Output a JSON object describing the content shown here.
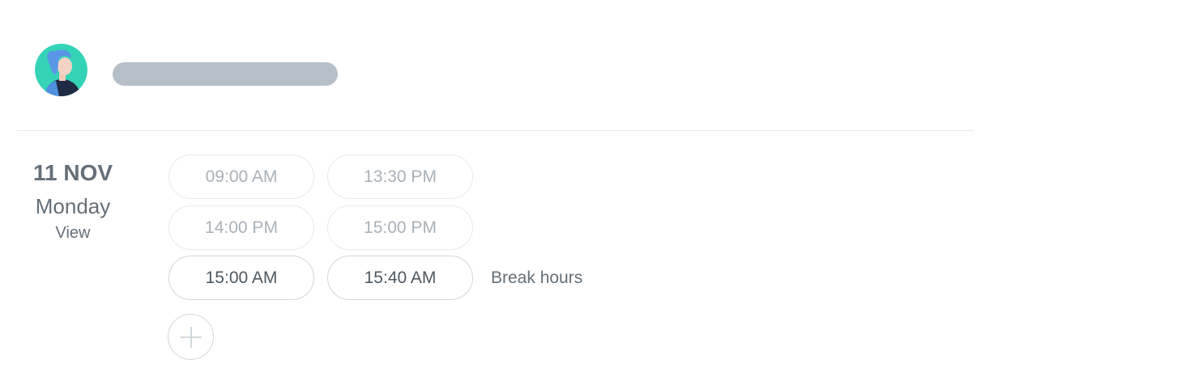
{
  "profile": {
    "avatar_icon": "user-avatar-icon",
    "colors": {
      "avatar_bg": "#34d3b8",
      "name_placeholder": "#b6bfc7"
    }
  },
  "schedule": {
    "date": "11 NOV",
    "weekday": "Monday",
    "view_label": "View",
    "slots": [
      {
        "time": "09:00 AM",
        "state": "disabled"
      },
      {
        "time": "13:30 PM",
        "state": "disabled"
      },
      {
        "time": "14:00 PM",
        "state": "disabled"
      },
      {
        "time": "15:00 PM",
        "state": "disabled"
      },
      {
        "time": "15:00 AM",
        "state": "active"
      },
      {
        "time": "15:40 AM",
        "state": "active"
      }
    ],
    "break_label": "Break hours",
    "add_icon": "plus-icon"
  }
}
